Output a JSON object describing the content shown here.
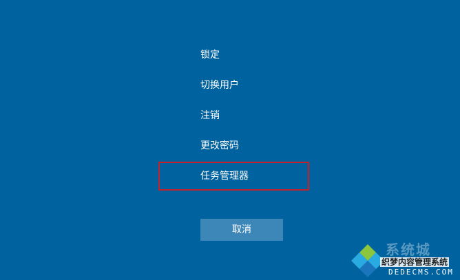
{
  "menu": {
    "items": [
      {
        "label": "锁定"
      },
      {
        "label": "切换用户"
      },
      {
        "label": "注销"
      },
      {
        "label": "更改密码"
      },
      {
        "label": "任务管理器"
      }
    ],
    "cancel_label": "取消"
  },
  "watermark": {
    "name": "系统城",
    "subtitle": "织梦内容管理系统",
    "url": "DEDECMS.COM"
  },
  "colors": {
    "background": "#0063a0",
    "button": "#3d86b8",
    "highlight": "#c4212b"
  }
}
